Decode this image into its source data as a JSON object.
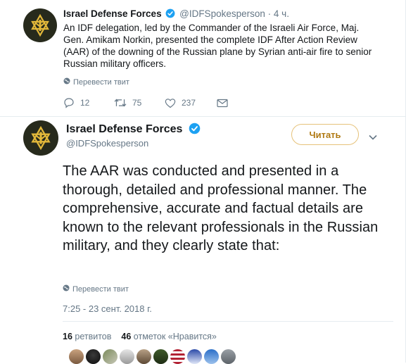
{
  "parent_tweet": {
    "author_name": "Israel Defense Forces",
    "handle": "@IDFSpokesperson",
    "separator": "·",
    "time": "4 ч.",
    "text": "An IDF delegation, led by the Commander of the Israeli Air Force, Maj. Gen. Amikam Norkin, presented the complete IDF After Action Review (AAR) of the downing of the Russian plane by Syrian anti-air fire to senior Russian military officers.",
    "translate_label": "Перевести твит",
    "actions": {
      "replies": "12",
      "retweets": "75",
      "likes": "237"
    }
  },
  "main_tweet": {
    "author_name": "Israel Defense Forces",
    "handle": "@IDFSpokesperson",
    "follow_label": "Читать",
    "text": "The AAR was conducted and presented in a thorough, detailed and professional manner. The comprehensive, accurate and factual details are known to the relevant professionals in the Russian military, and they clearly state that:",
    "translate_label": "Перевести твит",
    "timestamp": "7:25 - 23 сент. 2018 г.",
    "stats": {
      "retweets_count": "16",
      "retweets_label": "ретвитов",
      "likes_count": "46",
      "likes_label": "отметок «Нравится»"
    },
    "liker_avatars": [
      "avatar-1",
      "avatar-2",
      "avatar-3",
      "avatar-4",
      "avatar-5",
      "avatar-6",
      "avatar-7",
      "avatar-8",
      "avatar-9",
      "avatar-10"
    ]
  },
  "colors": {
    "verified_blue": "#1da1f2",
    "follow_border": "#e6c27a",
    "follow_text": "#b07a14",
    "muted_text": "#657786",
    "divider": "#e6ecf0",
    "avatar_bg": "#272a1c",
    "logo_gold": "#e3b83a"
  },
  "icons": {
    "verified": "verified-badge-icon",
    "globe": "globe-icon",
    "reply": "reply-icon",
    "retweet": "retweet-icon",
    "like": "heart-icon",
    "dm": "envelope-icon",
    "more": "chevron-down-icon"
  }
}
